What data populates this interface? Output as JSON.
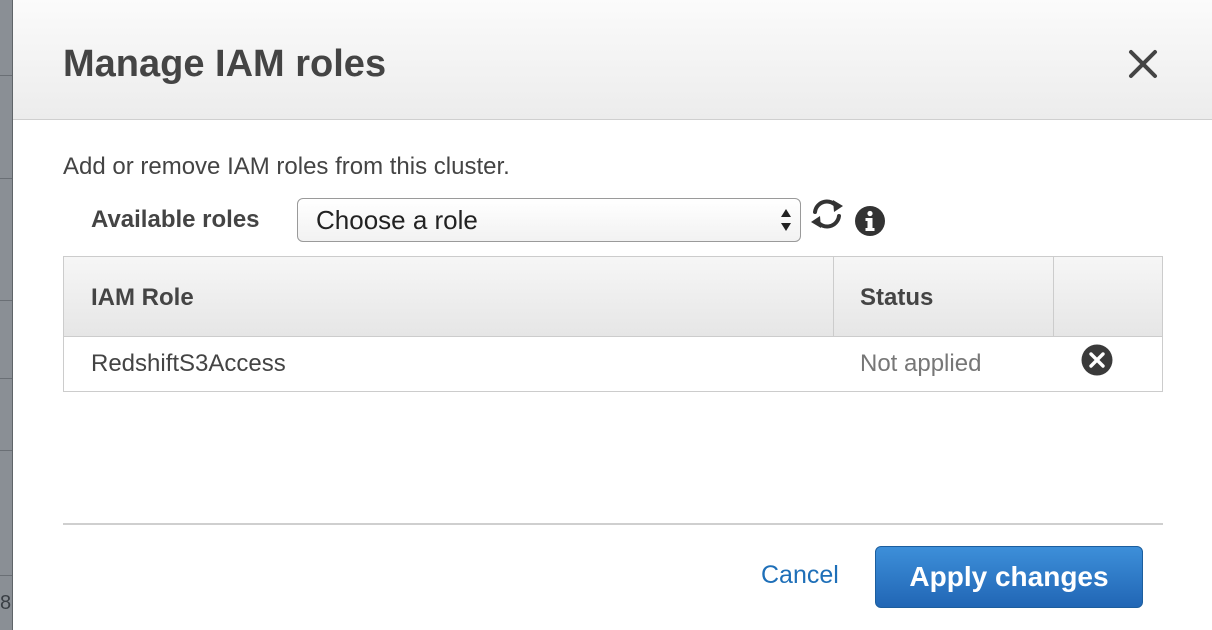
{
  "modal": {
    "title": "Manage IAM roles",
    "description": "Add or remove IAM roles from this cluster.",
    "close_icon": "close-icon"
  },
  "roles_picker": {
    "label": "Available roles",
    "selected": "Choose a role",
    "refresh_icon": "refresh-icon",
    "info_icon": "info-icon"
  },
  "table": {
    "headers": [
      "IAM Role",
      "Status"
    ],
    "rows": [
      {
        "role": "RedshiftS3Access",
        "status": "Not applied",
        "action_icon": "remove-circle-icon"
      }
    ]
  },
  "footer": {
    "cancel_label": "Cancel",
    "apply_label": "Apply changes"
  },
  "backdrop": {
    "edge_char": "8"
  },
  "colors": {
    "accent": "#2166b5",
    "link": "#1e6fb8",
    "text": "#444444",
    "muted_text": "#777777"
  }
}
